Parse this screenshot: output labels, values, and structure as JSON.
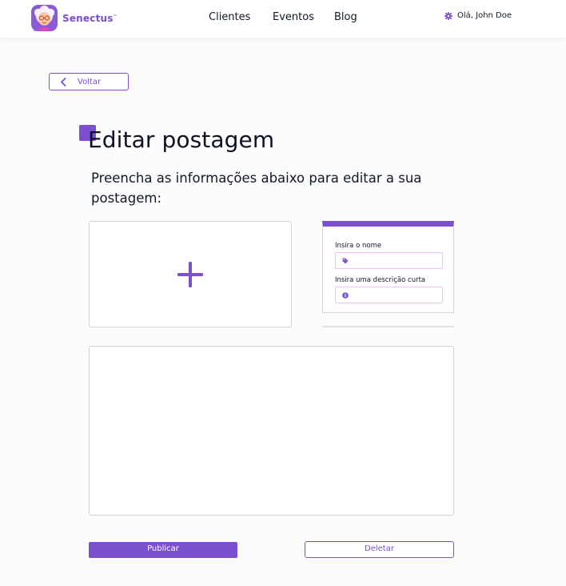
{
  "header": {
    "brand": "Senectus",
    "brand_mark": "™",
    "logo_icon": "elderly-woman-avatar-icon",
    "nav": [
      {
        "label": "Clientes"
      },
      {
        "label": "Eventos"
      },
      {
        "label": "Blog"
      }
    ],
    "greeting": "Olá, John Doe",
    "greeting_icon": "gear-icon"
  },
  "back": {
    "label": "Voltar",
    "icon": "chevron-left-icon"
  },
  "page": {
    "title": "Editar postagem",
    "subtitle": "Preencha as informações abaixo para editar a sua postagem:"
  },
  "image_upload": {
    "icon": "plus-icon"
  },
  "form": {
    "name_label": "Insira o nome",
    "name_icon": "tag-icon",
    "name_value": "",
    "description_label": "Insira uma descrição curta",
    "description_icon": "info-icon",
    "description_value": ""
  },
  "content": {
    "value": ""
  },
  "actions": {
    "publish_label": "Publicar",
    "delete_label": "Deletar"
  },
  "colors": {
    "primary": "#7a4fd0",
    "field_border": "#e7c6f2",
    "panel_border": "#d4d4d8",
    "text": "#111827"
  }
}
